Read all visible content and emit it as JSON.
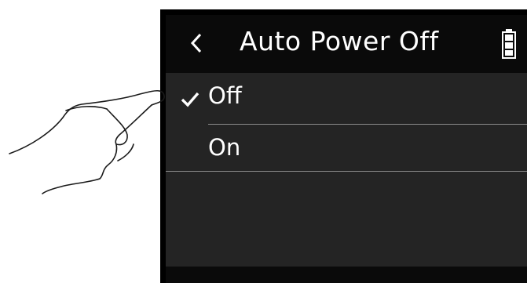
{
  "screen": {
    "title": "Auto Power Off",
    "back_icon": "chevron-left-icon",
    "battery_icon": "battery-full-icon"
  },
  "options": [
    {
      "label": "Off",
      "selected": true,
      "icon": "checkmark-icon"
    },
    {
      "label": "On",
      "selected": false
    }
  ],
  "colors": {
    "screen_background": "#242424",
    "header_background": "#0a0a0a",
    "text": "#ffffff",
    "divider": "#8c8c8c"
  },
  "illustration": "hand-pointing-icon"
}
